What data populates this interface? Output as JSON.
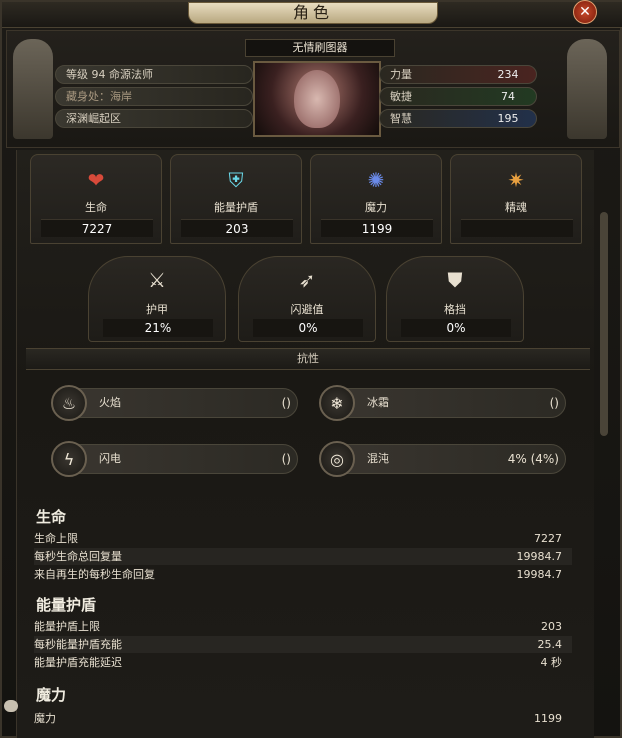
{
  "window": {
    "title": "角色",
    "close_icon": "close-icon"
  },
  "header": {
    "char_name": "无情刷图器",
    "info": [
      "等级 94 命源法师",
      "藏身处：海岸",
      "深渊崛起区"
    ],
    "stats": [
      {
        "label": "力量",
        "value": "234",
        "color": "#6a2a22"
      },
      {
        "label": "敏捷",
        "value": "74",
        "color": "#2a4a2a"
      },
      {
        "label": "智慧",
        "value": "195",
        "color": "#2a3a5a"
      }
    ]
  },
  "attributes": [
    {
      "label": "生命",
      "value": "7227",
      "icon": "heart-icon"
    },
    {
      "label": "能量护盾",
      "value": "203",
      "icon": "shield-icon"
    },
    {
      "label": "魔力",
      "value": "1199",
      "icon": "mana-icon"
    },
    {
      "label": "精魂",
      "value": "",
      "icon": "spirit-icon"
    }
  ],
  "defences": [
    {
      "label": "护甲",
      "value": "21%",
      "icon": "armour-icon"
    },
    {
      "label": "闪避值",
      "value": "0%",
      "icon": "evasion-icon"
    },
    {
      "label": "格挡",
      "value": "0%",
      "icon": "block-icon"
    }
  ],
  "resistances": {
    "header": "抗性",
    "items": [
      {
        "label": "火焰",
        "value": "()",
        "icon": "fire-icon"
      },
      {
        "label": "冰霜",
        "value": "()",
        "icon": "frost-icon"
      },
      {
        "label": "闪电",
        "value": "()",
        "icon": "lightning-icon"
      },
      {
        "label": "混沌",
        "value": "4% (4%)",
        "icon": "chaos-icon"
      }
    ]
  },
  "details": {
    "life": {
      "title": "生命",
      "rows": [
        {
          "label": "生命上限",
          "value": "7227"
        },
        {
          "label": "每秒生命总回复量",
          "value": "19984.7"
        },
        {
          "label": "来自再生的每秒生命回复",
          "value": "19984.7"
        }
      ]
    },
    "es": {
      "title": "能量护盾",
      "rows": [
        {
          "label": "能量护盾上限",
          "value": "203"
        },
        {
          "label": "每秒能量护盾充能",
          "value": "25.4"
        },
        {
          "label": "能量护盾充能延迟",
          "value": "4 秒"
        }
      ]
    },
    "mana": {
      "title": "魔力",
      "rows": [
        {
          "label": "魔力",
          "value": "1199"
        }
      ]
    }
  }
}
